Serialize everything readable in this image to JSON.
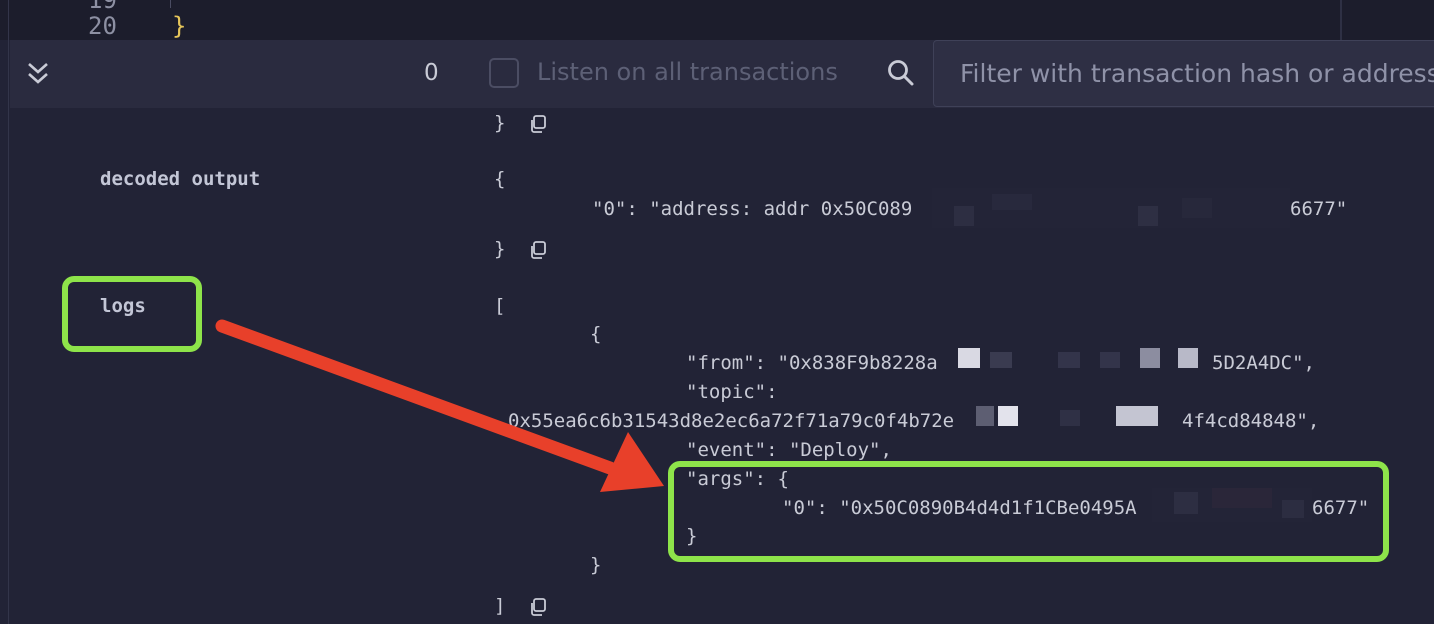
{
  "editor": {
    "prev_line_number": "19",
    "line_number": "20",
    "closing_brace": "}"
  },
  "toolbar": {
    "collapse_icon": "double-chevron-down-icon",
    "transaction_count": "0",
    "listen_label": "Listen on all transactions",
    "listen_checked": false,
    "search_icon": "search-icon",
    "filter_placeholder": "Filter with transaction hash or address"
  },
  "output": {
    "prev_close": "}",
    "decoded_output_label": "decoded output",
    "decoded_open": "{",
    "decoded_entry": "\"0\": \"address: addr 0x50C089",
    "decoded_entry_tail": "6677\"",
    "decoded_close": "}",
    "logs_label": "logs",
    "logs_open": "[",
    "log_open": "{",
    "from_line": "\"from\": \"0x838F9b8228a",
    "from_tail": "5D2A4DC\",",
    "topic_key": "\"topic\":",
    "topic_value": "0x55ea6c6b31543d8e2ec6a72f71a79c0f4b72e",
    "topic_tail": "4f4cd84848\",",
    "event_line": "\"event\": \"Deploy\",",
    "args_open": "\"args\": {",
    "args_entry": "\"0\": \"0x50C0890B4d4d1f1CBe0495A",
    "args_entry_tail": "6677\"",
    "args_close": "}",
    "log_close": "}",
    "logs_close": "]",
    "copy_icon": "copy-icon"
  },
  "annotations": {
    "highlight_color": "#8ee44a",
    "arrow_color": "#e8402a"
  }
}
